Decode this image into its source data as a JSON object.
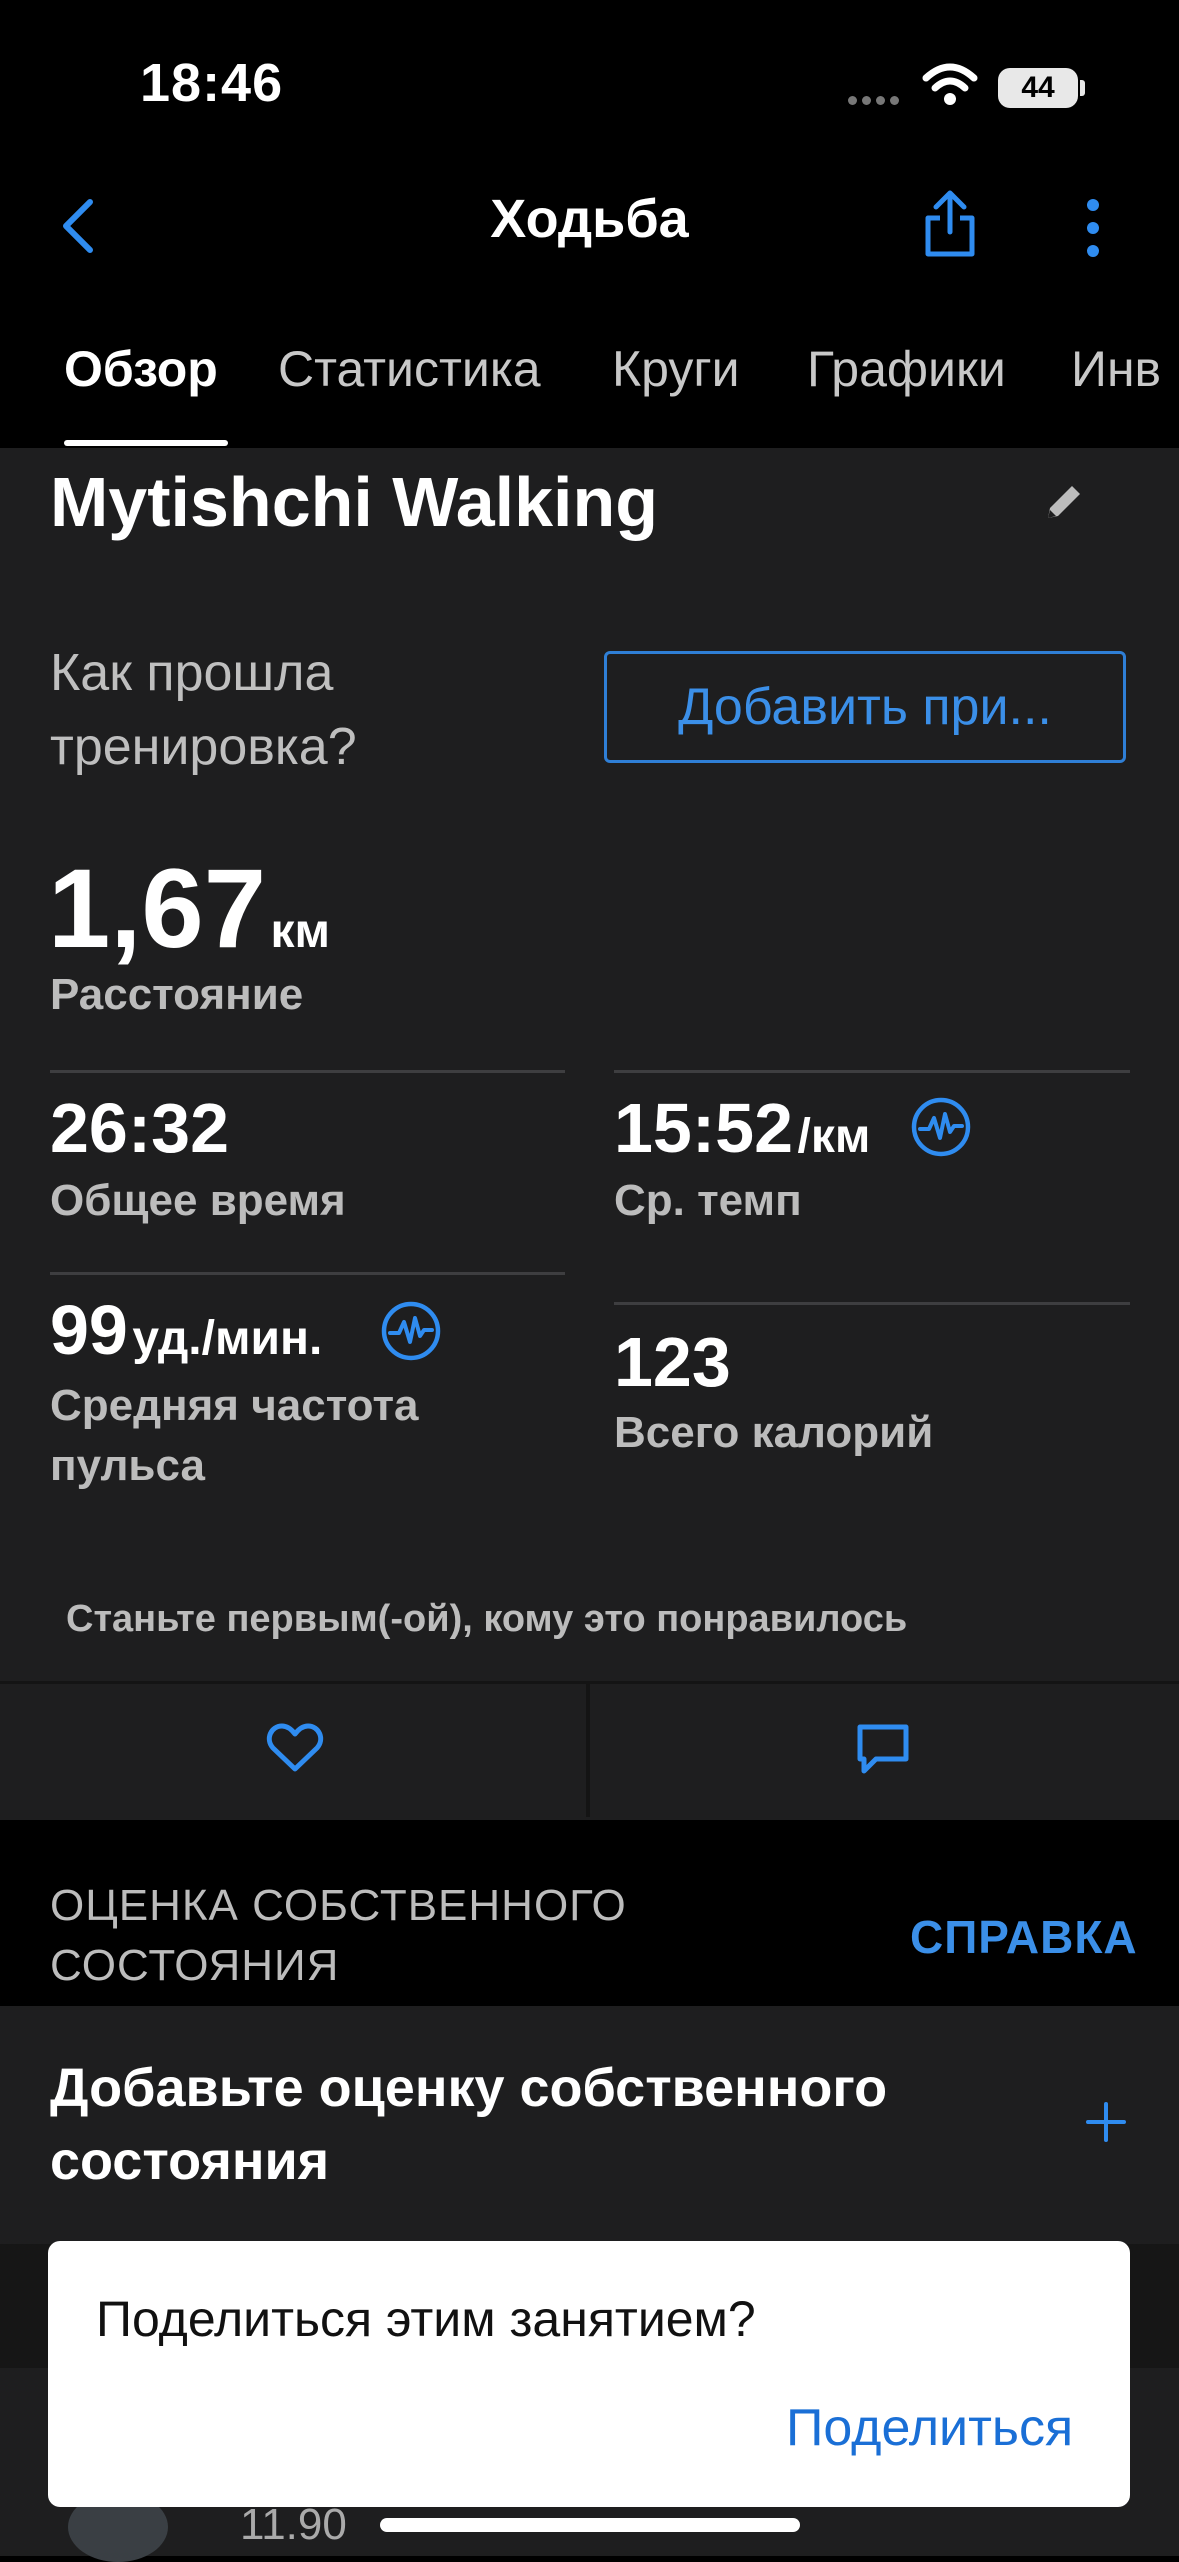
{
  "status_bar": {
    "time": "18:46",
    "battery": "44"
  },
  "nav": {
    "title": "Ходьба"
  },
  "tabs": [
    {
      "label": "Обзор",
      "active": true
    },
    {
      "label": "Статистика",
      "active": false
    },
    {
      "label": "Круги",
      "active": false
    },
    {
      "label": "Графики",
      "active": false
    },
    {
      "label": "Инв",
      "active": false
    }
  ],
  "activity": {
    "title": "Mytishchi Walking",
    "question": "Как прошла тренировка?",
    "add_button": "Добавить при..."
  },
  "stats": {
    "distance": {
      "value": "1,67",
      "unit": "км",
      "label": "Расстояние"
    },
    "total_time": {
      "value": "26:32",
      "label": "Общее время"
    },
    "avg_pace": {
      "value": "15:52",
      "unit": "/км",
      "label": "Ср. темп"
    },
    "avg_hr": {
      "value": "99",
      "unit": "уд./мин.",
      "label": "Средняя частота пульса"
    },
    "calories": {
      "value": "123",
      "label": "Всего калорий"
    }
  },
  "social": {
    "likes_text": "Станьте первым(-ой), кому это понравилось"
  },
  "self_eval": {
    "section_title": "ОЦЕНКА СОБСТВЕННОГО СОСТОЯНИЯ",
    "help_link": "СПРАВКА",
    "add_text": "Добавьте оценку собственного состояния"
  },
  "lower_peek": {
    "value": "11.90"
  },
  "modal": {
    "question": "Поделиться этим занятием?",
    "share_button": "Поделиться"
  },
  "colors": {
    "accent": "#3b8fe8",
    "card": "#1e1e1f",
    "background": "#000000"
  },
  "icons": [
    "back-chevron-icon",
    "share-icon",
    "more-vertical-icon",
    "edit-pencil-icon",
    "heart-rate-icon",
    "heart-icon",
    "comment-icon",
    "plus-icon",
    "wifi-icon"
  ]
}
